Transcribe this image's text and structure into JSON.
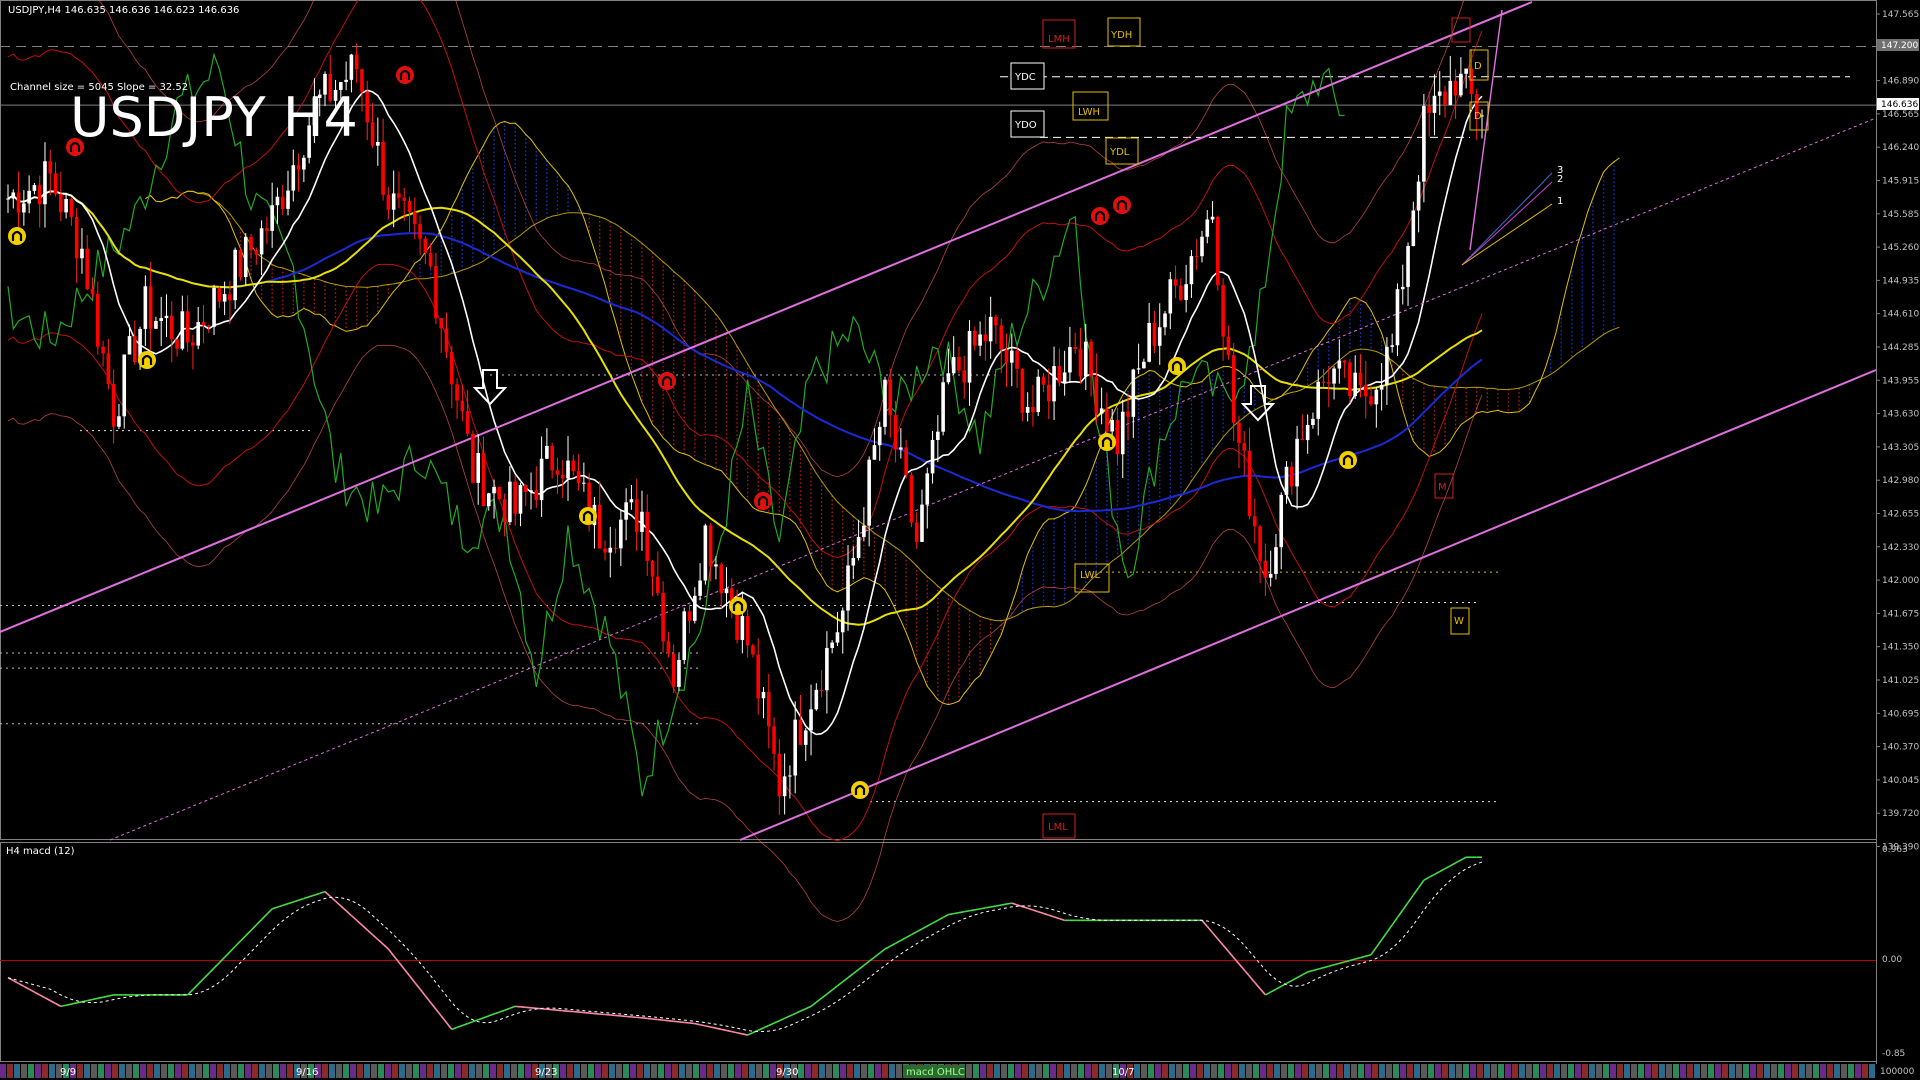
{
  "window": {
    "header": "USDJPY,H4  146.635 146.636 146.623 146.636",
    "channel_info": "Channel size = 5045  Slope = 32.52",
    "big_title": "USDJPY H4"
  },
  "colors": {
    "background": "#000000",
    "bull": "#ffffff",
    "bear": "#ff0000",
    "ichimoku_bull_cloud": "#1a3ad6",
    "ichimoku_bear_cloud": "#c21b1b",
    "channel": "#e070e0",
    "macd_up": "#44dd44",
    "macd_down": "#ff88aa",
    "grid_text": "#c0c0c0"
  },
  "main_axis": {
    "ticks": [
      "147.565",
      "147.200",
      "146.890",
      "146.565",
      "146.240",
      "145.915",
      "145.585",
      "145.260",
      "144.935",
      "144.610",
      "144.285",
      "143.955",
      "143.630",
      "143.305",
      "142.980",
      "142.655",
      "142.330",
      "142.000",
      "141.675",
      "141.350",
      "141.025",
      "140.695",
      "140.370",
      "140.045",
      "139.720",
      "139.390"
    ],
    "ymin": 139.39,
    "ymax": 147.6,
    "current_price": "146.636",
    "marked_level": "147.200"
  },
  "levels": {
    "LMH": "LMH",
    "YDH": "YDH",
    "YDC": "YDC",
    "LWH": "LWH",
    "YDO": "YDO",
    "YDL": "YDL",
    "LWL": "LWL",
    "LML": "LML",
    "D": "D",
    "W": "W",
    "M": "M",
    "fib_labels": [
      "3",
      "2",
      "1"
    ]
  },
  "date_axis": {
    "labels": [
      "9/9",
      "9/16",
      "9/23",
      "9/30",
      "10/7"
    ],
    "footer_center": "macd OHLC"
  },
  "macd_panel": {
    "title": "H4 macd (12)",
    "ticks": [
      "0.963",
      "0.00",
      "-0.85"
    ],
    "bottom_value": "100000"
  },
  "chart_data": {
    "type": "candlestick",
    "symbol": "USDJPY",
    "timeframe": "H4",
    "x_date_labels": [
      "9/9",
      "9/16",
      "9/23",
      "9/30",
      "10/7"
    ],
    "price_range": [
      139.39,
      147.6
    ],
    "close_path": [
      {
        "bar": 0,
        "close": 145.7
      },
      {
        "bar": 8,
        "close": 145.9
      },
      {
        "bar": 14,
        "close": 145.2
      },
      {
        "bar": 20,
        "close": 143.6
      },
      {
        "bar": 26,
        "close": 144.6
      },
      {
        "bar": 34,
        "close": 144.3
      },
      {
        "bar": 42,
        "close": 144.9
      },
      {
        "bar": 50,
        "close": 145.5
      },
      {
        "bar": 58,
        "close": 146.6
      },
      {
        "bar": 66,
        "close": 147.0
      },
      {
        "bar": 72,
        "close": 145.7
      },
      {
        "bar": 80,
        "close": 145.0
      },
      {
        "bar": 88,
        "close": 143.0
      },
      {
        "bar": 96,
        "close": 142.6
      },
      {
        "bar": 104,
        "close": 143.2
      },
      {
        "bar": 112,
        "close": 142.4
      },
      {
        "bar": 120,
        "close": 142.6
      },
      {
        "bar": 126,
        "close": 141.0
      },
      {
        "bar": 132,
        "close": 142.4
      },
      {
        "bar": 140,
        "close": 141.3
      },
      {
        "bar": 146,
        "close": 139.9
      },
      {
        "bar": 152,
        "close": 140.8
      },
      {
        "bar": 158,
        "close": 141.6
      },
      {
        "bar": 166,
        "close": 143.7
      },
      {
        "bar": 172,
        "close": 142.3
      },
      {
        "bar": 178,
        "close": 143.9
      },
      {
        "bar": 186,
        "close": 144.4
      },
      {
        "bar": 194,
        "close": 143.6
      },
      {
        "bar": 202,
        "close": 144.3
      },
      {
        "bar": 210,
        "close": 143.3
      },
      {
        "bar": 216,
        "close": 144.3
      },
      {
        "bar": 222,
        "close": 144.9
      },
      {
        "bar": 228,
        "close": 145.6
      },
      {
        "bar": 232,
        "close": 143.5
      },
      {
        "bar": 238,
        "close": 142.0
      },
      {
        "bar": 244,
        "close": 143.3
      },
      {
        "bar": 250,
        "close": 144.0
      },
      {
        "bar": 256,
        "close": 143.7
      },
      {
        "bar": 262,
        "close": 144.2
      },
      {
        "bar": 268,
        "close": 146.4
      },
      {
        "bar": 274,
        "close": 146.9
      },
      {
        "bar": 278,
        "close": 146.6
      }
    ],
    "macd_path": [
      {
        "bar": 0,
        "value": -0.15
      },
      {
        "bar": 10,
        "value": -0.4
      },
      {
        "bar": 20,
        "value": -0.3
      },
      {
        "bar": 34,
        "value": -0.3
      },
      {
        "bar": 50,
        "value": 0.45
      },
      {
        "bar": 60,
        "value": 0.6
      },
      {
        "bar": 72,
        "value": 0.1
      },
      {
        "bar": 84,
        "value": -0.6
      },
      {
        "bar": 96,
        "value": -0.4
      },
      {
        "bar": 108,
        "value": -0.45
      },
      {
        "bar": 120,
        "value": -0.5
      },
      {
        "bar": 130,
        "value": -0.55
      },
      {
        "bar": 140,
        "value": -0.65
      },
      {
        "bar": 152,
        "value": -0.4
      },
      {
        "bar": 166,
        "value": 0.1
      },
      {
        "bar": 178,
        "value": 0.4
      },
      {
        "bar": 190,
        "value": 0.5
      },
      {
        "bar": 200,
        "value": 0.35
      },
      {
        "bar": 214,
        "value": 0.35
      },
      {
        "bar": 226,
        "value": 0.35
      },
      {
        "bar": 238,
        "value": -0.3
      },
      {
        "bar": 246,
        "value": -0.1
      },
      {
        "bar": 258,
        "value": 0.05
      },
      {
        "bar": 268,
        "value": 0.7
      },
      {
        "bar": 276,
        "value": 0.9
      }
    ],
    "macd_range": [
      -0.85,
      0.963
    ]
  }
}
